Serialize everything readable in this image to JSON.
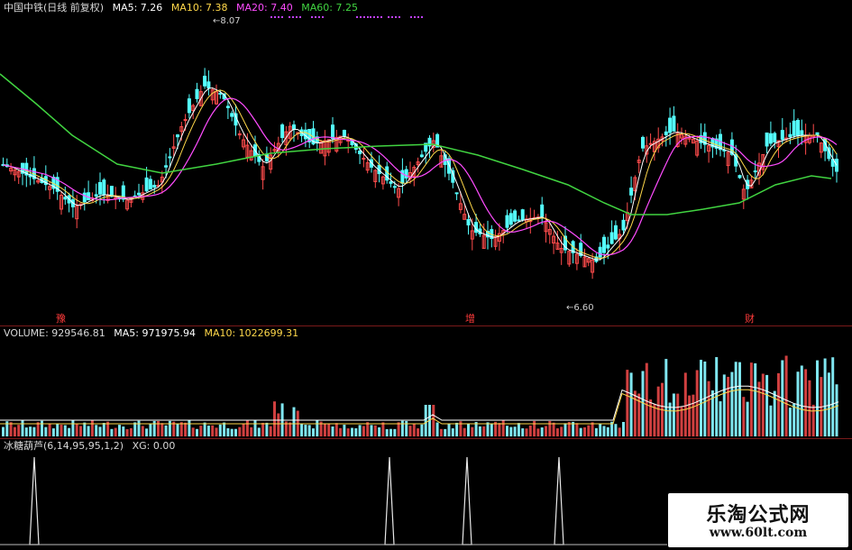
{
  "price_panel": {
    "title": "中国中铁(日线 前复权)",
    "ma5": "MA5: 7.26",
    "ma10": "MA10: 7.38",
    "ma20": "MA20: 7.40",
    "ma60": "MA60: 7.25",
    "high_label": "8.07",
    "low_label": "6.60",
    "markers": [
      "豫",
      "增",
      "财"
    ],
    "colors": {
      "ma5": "#ffffff",
      "ma10": "#ffd84a",
      "ma20": "#ff4cff",
      "ma60": "#41d441",
      "up": "#ff4c4c",
      "down": "#54ffff"
    }
  },
  "volume_panel": {
    "title": "VOLUME: 929546.81",
    "ma5": "MA5: 971975.94",
    "ma10": "MA10: 1022699.31"
  },
  "indicator_panel": {
    "title": "冰糖葫芦(6,14,95,95,1,2)",
    "xg": "XG: 0.00"
  },
  "watermark": {
    "title": "乐淘公式网",
    "url": "www.60lt.com"
  }
}
